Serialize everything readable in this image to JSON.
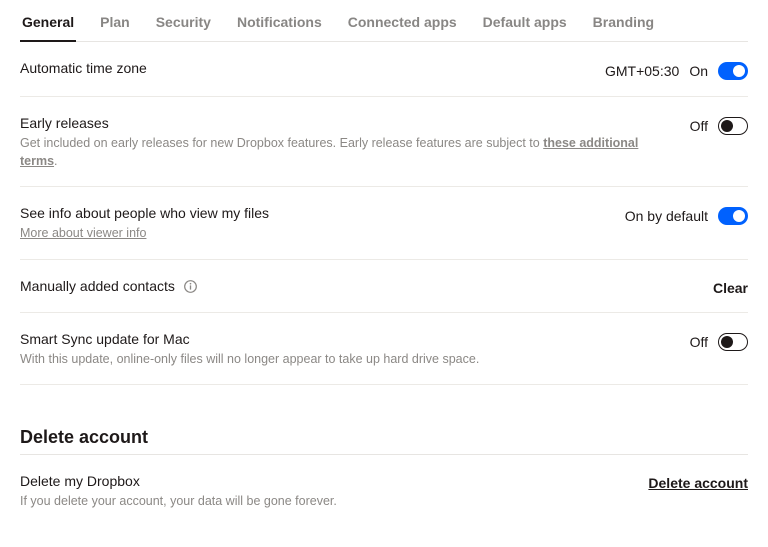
{
  "tabs": {
    "items": [
      "General",
      "Plan",
      "Security",
      "Notifications",
      "Connected apps",
      "Default apps",
      "Branding"
    ],
    "active_index": 0
  },
  "settings": {
    "timezone": {
      "title": "Automatic time zone",
      "value": "GMT+05:30",
      "state_label": "On",
      "on": true
    },
    "early": {
      "title": "Early releases",
      "sub_prefix": "Get included on early releases for new Dropbox features. Early release features are subject to ",
      "sub_link": "these additional terms",
      "sub_suffix": ".",
      "state_label": "Off",
      "on": false
    },
    "viewer": {
      "title": "See info about people who view my files",
      "sub_link": "More about viewer info",
      "state_label": "On by default",
      "on": true
    },
    "contacts": {
      "title": "Manually added contacts",
      "action": "Clear"
    },
    "smartsync": {
      "title": "Smart Sync update for Mac",
      "sub": "With this update, online-only files will no longer appear to take up hard drive space.",
      "state_label": "Off",
      "on": false
    }
  },
  "delete_section": {
    "heading": "Delete account",
    "title": "Delete my Dropbox",
    "sub": "If you delete your account, your data will be gone forever.",
    "action": "Delete account"
  }
}
